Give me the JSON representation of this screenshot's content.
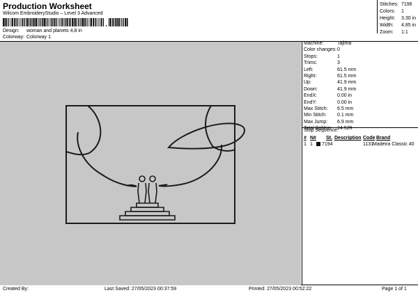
{
  "header": {
    "title": "Production Worksheet",
    "subtitle": "Wilcom EmbroideryStudio – Level 3 Advanced",
    "design_label": "Design:",
    "design_value": "woman and planets 4,8 in",
    "colorway_label": "Colorway:",
    "colorway_value": "Colorway 1"
  },
  "top_stats": [
    {
      "label": "Stitches:",
      "value": "7196"
    },
    {
      "label": "Colors:",
      "value": "1"
    },
    {
      "label": "Height:",
      "value": "3.30 in"
    },
    {
      "label": "Width:",
      "value": "4.85 in"
    },
    {
      "label": "Zoom:",
      "value": "1:1"
    }
  ],
  "info": [
    {
      "label": "Machine:",
      "value": "Tajima"
    },
    {
      "label": "Color changes:",
      "value": "0"
    },
    {
      "label": "Stops:",
      "value": "1"
    },
    {
      "label": "Trims:",
      "value": "3"
    },
    {
      "label": "Left:",
      "value": "61.5 mm"
    },
    {
      "label": "Right:",
      "value": "61.5 mm"
    },
    {
      "label": "Up:",
      "value": "41.9 mm"
    },
    {
      "label": "Down:",
      "value": "41.9 mm"
    },
    {
      "label": "EndX:",
      "value": "0.00 in"
    },
    {
      "label": "EndY:",
      "value": "0.00 in"
    },
    {
      "label": "Max Stitch:",
      "value": "6.5 mm"
    },
    {
      "label": "Min Stitch:",
      "value": "0.1 mm"
    },
    {
      "label": "Max Jump:",
      "value": "6.9 mm"
    },
    {
      "label": "Total Bobbin:",
      "value": "24.52ft"
    }
  ],
  "stop_sequence": {
    "title": "Stop Sequence:",
    "headers": {
      "num": "#",
      "n": "N#",
      "st": "St.",
      "description": "Description",
      "code": "Code",
      "brand": "Brand"
    },
    "rows": [
      {
        "num": "1",
        "n": "1",
        "st": "7194",
        "description": "",
        "code": "1131",
        "brand": "Madeira Classic 40",
        "color": "#111111"
      }
    ]
  },
  "footer": {
    "created_by": "Created By:",
    "last_saved": "Last Saved: 27/05/2023 00:37:59",
    "printed": "Printed: 27/05/2023 00:52:22",
    "page": "Page 1 of 1"
  }
}
